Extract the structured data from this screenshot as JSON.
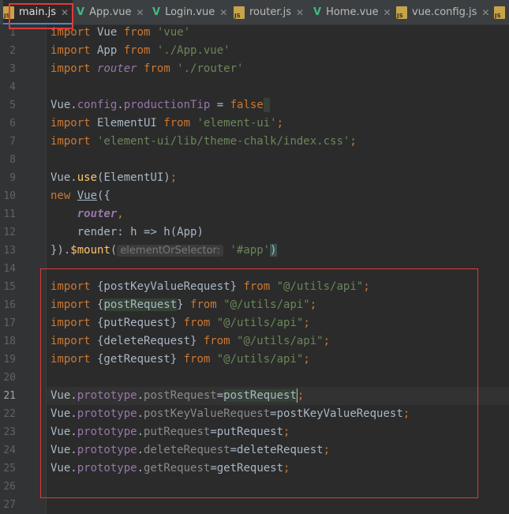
{
  "tabs": [
    {
      "label": "main.js",
      "type": "js"
    },
    {
      "label": "App.vue",
      "type": "vue"
    },
    {
      "label": "Login.vue",
      "type": "vue"
    },
    {
      "label": "router.js",
      "type": "js"
    },
    {
      "label": "Home.vue",
      "type": "vue"
    },
    {
      "label": "vue.config.js",
      "type": "js"
    }
  ],
  "line_numbers": [
    "1",
    "2",
    "3",
    "4",
    "5",
    "6",
    "7",
    "8",
    "9",
    "10",
    "11",
    "12",
    "13",
    "14",
    "15",
    "16",
    "17",
    "18",
    "19",
    "20",
    "21",
    "22",
    "23",
    "24",
    "25",
    "26",
    "27"
  ],
  "code": {
    "l1": {
      "kw": "import",
      "name": " Vue ",
      "kw2": "from",
      "str": " 'vue'"
    },
    "l2": {
      "kw": "import",
      "name": " App ",
      "kw2": "from",
      "str": " './App.vue'"
    },
    "l3": {
      "kw": "import",
      "name": "router",
      "kw2": "from",
      "str": " './router'"
    },
    "l5": {
      "a": "Vue.",
      "b": "config",
      "c": ".",
      "d": "productionTip",
      "e": " = ",
      "f": "false"
    },
    "l6": {
      "kw": "import",
      "name": " ElementUI ",
      "kw2": "from",
      "str": " 'element-ui'",
      "end": ";"
    },
    "l7": {
      "kw": "import",
      "str": " 'element-ui/lib/theme-chalk/index.css'",
      "end": ";"
    },
    "l9": {
      "a": "Vue.",
      "b": "use",
      "c": "(ElementUI)",
      "end": ";"
    },
    "l10": {
      "kw": "new ",
      "name": "Vue",
      "rest": "({"
    },
    "l11": {
      "name": "router",
      "end": ","
    },
    "l12": {
      "a": "render",
      "b": ": h => h(App)"
    },
    "l13": {
      "a": "})",
      "b": ".",
      "c": "$mount",
      "d": "(",
      "hint": "elementOrSelector:",
      "str": " '#app'",
      "e": ")"
    },
    "l15": {
      "kw": "import",
      "a": " {postKeyValueRequest} ",
      "kw2": "from",
      "str": " \"@/utils/api\"",
      "end": ";"
    },
    "l16": {
      "kw": "import",
      "a": " {",
      "b": "postRequest",
      "c": "} ",
      "kw2": "from",
      "str": " \"@/utils/api\"",
      "end": ";"
    },
    "l17": {
      "kw": "import",
      "a": " {putRequest} ",
      "kw2": "from",
      "str": " \"@/utils/api\"",
      "end": ";"
    },
    "l18": {
      "kw": "import",
      "a": " {deleteRequest} ",
      "kw2": "from",
      "str": " \"@/utils/api\"",
      "end": ";"
    },
    "l19": {
      "kw": "import",
      "a": " {getRequest} ",
      "kw2": "from",
      "str": " \"@/utils/api\"",
      "end": ";"
    },
    "l21": {
      "a": "Vue.",
      "b": "prototype",
      "c": ".",
      "d": "postRequest",
      "e": "=",
      "f": "postRequest",
      "end": ";"
    },
    "l22": {
      "a": "Vue.",
      "b": "prototype",
      "c": ".",
      "d": "postKeyValueRequest",
      "e": "=postKeyValueRequest",
      "end": ";"
    },
    "l23": {
      "a": "Vue.",
      "b": "prototype",
      "c": ".",
      "d": "putRequest",
      "e": "=putRequest",
      "end": ";"
    },
    "l24": {
      "a": "Vue.",
      "b": "prototype",
      "c": ".",
      "d": "deleteRequest",
      "e": "=deleteRequest",
      "end": ";"
    },
    "l25": {
      "a": "Vue.",
      "b": "prototype",
      "c": ".",
      "d": "getRequest",
      "e": "=getRequest",
      "end": ";"
    }
  },
  "colors": {
    "background": "#2b2b2b",
    "keyword": "#cc7832",
    "string": "#6a8759",
    "property": "#9876aa",
    "function": "#ffc66d",
    "annotation_box": "#e03a3a"
  }
}
